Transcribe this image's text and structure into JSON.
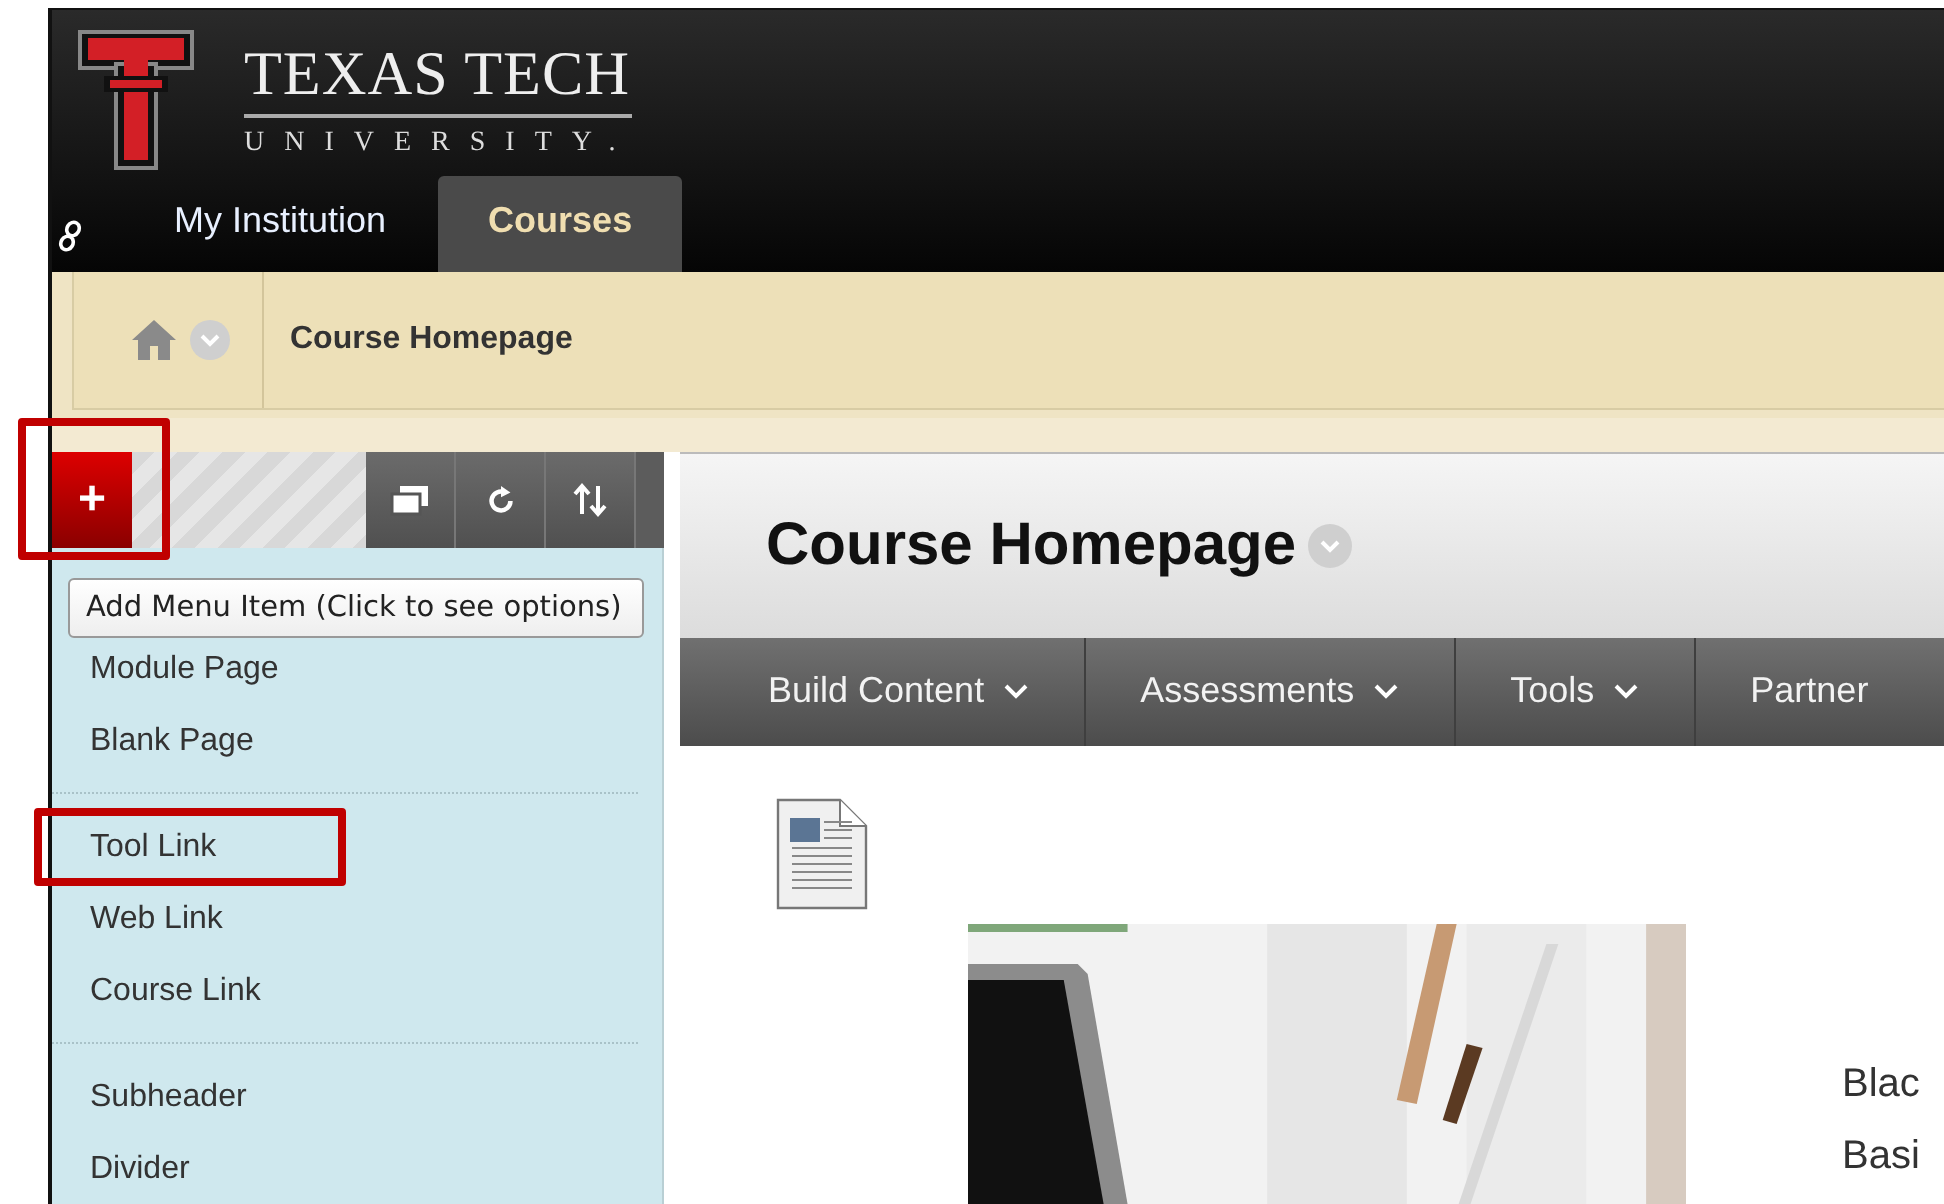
{
  "header": {
    "logo_title": "TEXAS TECH",
    "logo_subtitle": "UNIVERSITY.",
    "tabs": [
      {
        "label": "My Institution",
        "selected": false
      },
      {
        "label": "Courses",
        "selected": true
      }
    ]
  },
  "breadcrumb": {
    "items": [
      "Course Homepage"
    ]
  },
  "course_menu": {
    "add_button": {
      "label": "+",
      "highlighted": true
    },
    "tooltip": "Add Menu Item (Click to see options)",
    "groups": [
      [
        {
          "label": "Module Page",
          "highlighted": false
        },
        {
          "label": "Blank Page",
          "highlighted": false
        }
      ],
      [
        {
          "label": "Tool Link",
          "highlighted": true
        },
        {
          "label": "Web Link",
          "highlighted": false
        },
        {
          "label": "Course Link",
          "highlighted": false
        }
      ],
      [
        {
          "label": "Subheader",
          "highlighted": false
        },
        {
          "label": "Divider",
          "highlighted": false
        }
      ]
    ]
  },
  "page": {
    "title": "Course Homepage",
    "nav": [
      {
        "label": "Build Content"
      },
      {
        "label": "Assessments"
      },
      {
        "label": "Tools"
      },
      {
        "label": "Partner"
      }
    ],
    "content": {
      "image": {
        "kind": "picture"
      },
      "text_lines": [
        "Blac",
        "Basi"
      ]
    }
  }
}
